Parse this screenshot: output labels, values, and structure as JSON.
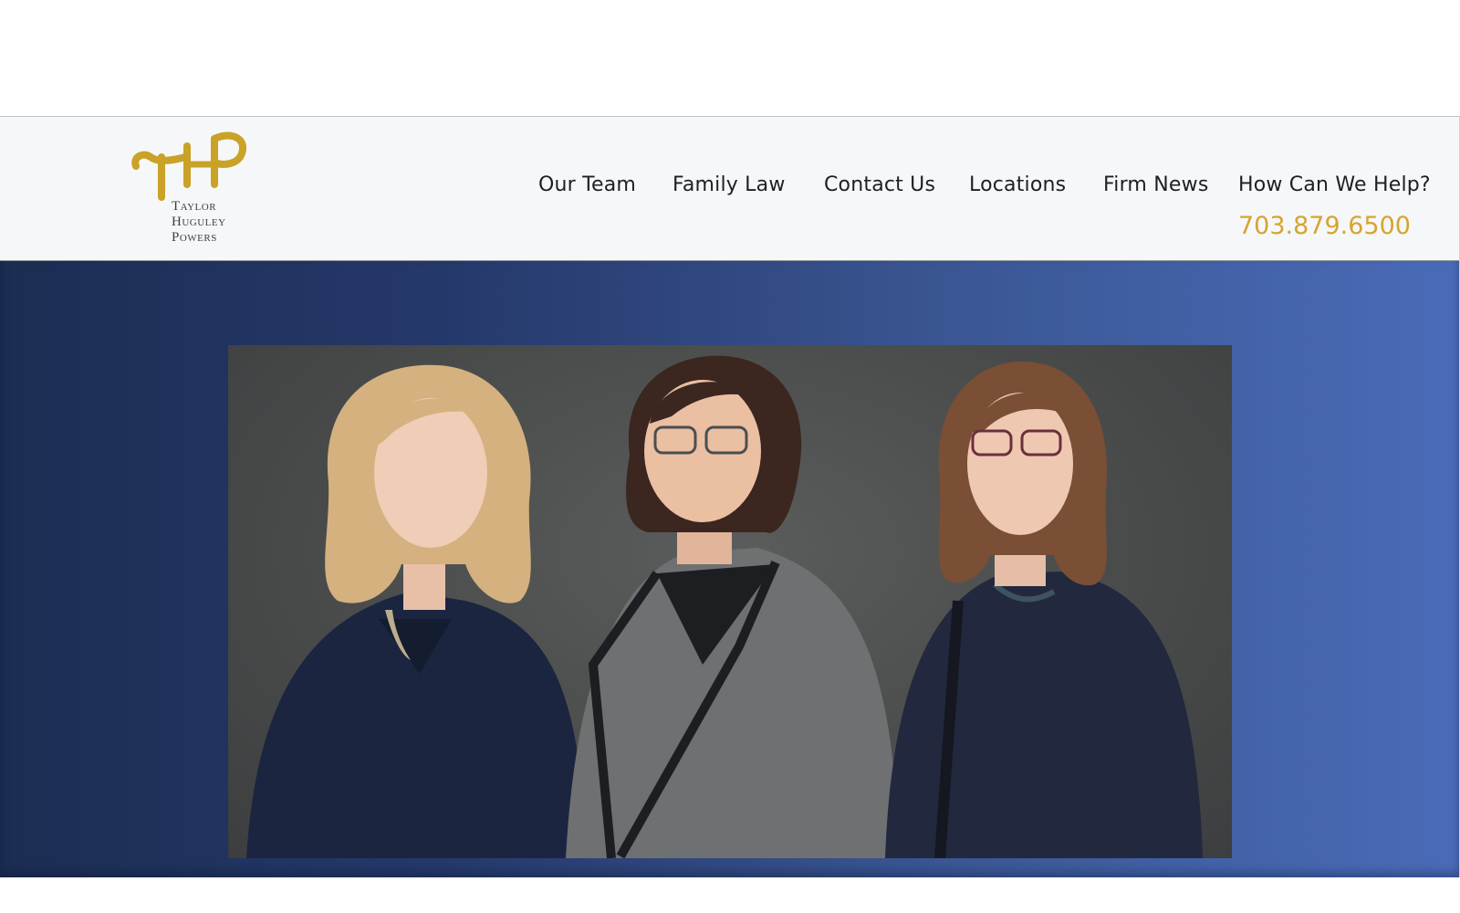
{
  "brand": {
    "name_line1": "Taylor",
    "name_line2": "Huguley",
    "name_line3": "Powers",
    "logo_color": "#c9a227"
  },
  "nav": {
    "items": [
      {
        "label": "Our Team"
      },
      {
        "label": "Family Law"
      },
      {
        "label": "Contact Us"
      },
      {
        "label": "Locations"
      },
      {
        "label": "Firm News"
      },
      {
        "label": "How Can We Help?"
      }
    ],
    "phone": "703.879.6500",
    "phone_color": "#d6a431"
  },
  "hero": {
    "photo_icon": "team-portrait-image",
    "gradient_start": "#1c2d53",
    "gradient_end": "#4a6bb8"
  }
}
